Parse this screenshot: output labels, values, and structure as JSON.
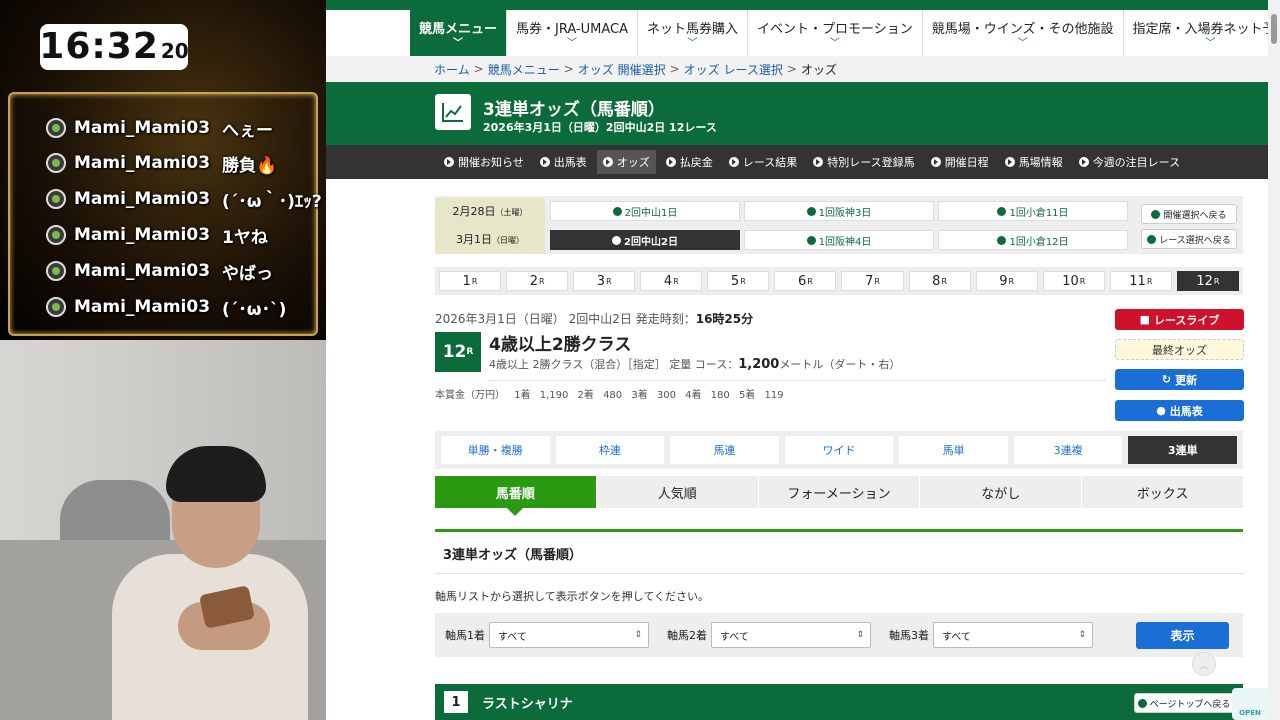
{
  "clock": {
    "hm": "16:32",
    "sec": "20"
  },
  "chat": [
    {
      "user": "Mami_Mami03",
      "msg": "へぇー"
    },
    {
      "user": "Mami_Mami03",
      "msg": "勝負🔥"
    },
    {
      "user": "Mami_Mami03",
      "msg": "(´･ω｀･)ｴｯ?"
    },
    {
      "user": "Mami_Mami03",
      "msg": "1ヤね"
    },
    {
      "user": "Mami_Mami03",
      "msg": "やばっ"
    },
    {
      "user": "Mami_Mami03",
      "msg": "(´･ω･`)"
    }
  ],
  "nav": [
    "競馬メニュー",
    "馬券・JRA-UMACA",
    "ネット馬券購入",
    "イベント・プロモーション",
    "競馬場・ウインズ・その他施設",
    "指定席・入場券ネット予約"
  ],
  "breadcrumb": [
    "ホーム",
    "競馬メニュー",
    "オッズ 開催選択",
    "オッズ レース選択",
    "オッズ"
  ],
  "hero": {
    "title": "3連単オッズ（馬番順）",
    "sub": "2026年3月1日（日曜）2回中山2日 12レース"
  },
  "subnav": [
    "開催お知らせ",
    "出馬表",
    "オッズ",
    "払戻金",
    "レース結果",
    "特別レース登録馬",
    "開催日程",
    "馬場情報",
    "今週の注目レース"
  ],
  "dates": [
    {
      "label": "2月28日",
      "dow": "（土曜）",
      "meets": [
        "2回中山1日",
        "1回阪神3日",
        "1回小倉11日"
      ]
    },
    {
      "label": "3月1日",
      "dow": "（日曜）",
      "meets": [
        "2回中山2日",
        "1回阪神4日",
        "1回小倉12日"
      ]
    }
  ],
  "side_buttons": [
    "開催選択へ戻る",
    "レース選択へ戻る"
  ],
  "races": [
    "1",
    "2",
    "3",
    "4",
    "5",
    "6",
    "7",
    "8",
    "9",
    "10",
    "11",
    "12"
  ],
  "race_suffix": "R",
  "race": {
    "meta_prefix": "2026年3月1日（日曜） 2回中山2日 発走時刻：",
    "post_time": "16時25分",
    "num": "12",
    "name": "4歳以上2勝クラス",
    "cond_prefix": "4歳以上 2勝クラス（混合）［指定］ 定量 コース：",
    "distance": "1,200",
    "cond_suffix": "メートル（ダート・右）",
    "prize": "本賞金（万円） 1着 1,190 2着 480 3着 300 4着 180 5着 119"
  },
  "race_buttons": {
    "live": "レースライブ",
    "final": "最終オッズ",
    "update": "更新",
    "table": "出馬表"
  },
  "bet_types": [
    "単勝・複勝",
    "枠連",
    "馬連",
    "ワイド",
    "馬単",
    "3連複",
    "3連単"
  ],
  "order_tabs": [
    "馬番順",
    "人気順",
    "フォーメーション",
    "ながし",
    "ボックス"
  ],
  "section_title": "3連単オッズ（馬番順）",
  "instruction": "軸馬リストから選択して表示ボタンを押してください。",
  "axis": [
    {
      "label": "軸馬1着",
      "value": "すべて"
    },
    {
      "label": "軸馬2着",
      "value": "すべて"
    },
    {
      "label": "軸馬3着",
      "value": "すべて"
    }
  ],
  "show_button": "表示",
  "horse": {
    "num": "1",
    "name": "ラストシャリナ"
  },
  "page_top": "ページトップへ戻る",
  "open_label": "OPEN",
  "colors": {
    "jra_green": "#0b6b3a",
    "accent_green": "#2a9a12",
    "blue": "#1a6fd6",
    "red": "#d0112b"
  }
}
